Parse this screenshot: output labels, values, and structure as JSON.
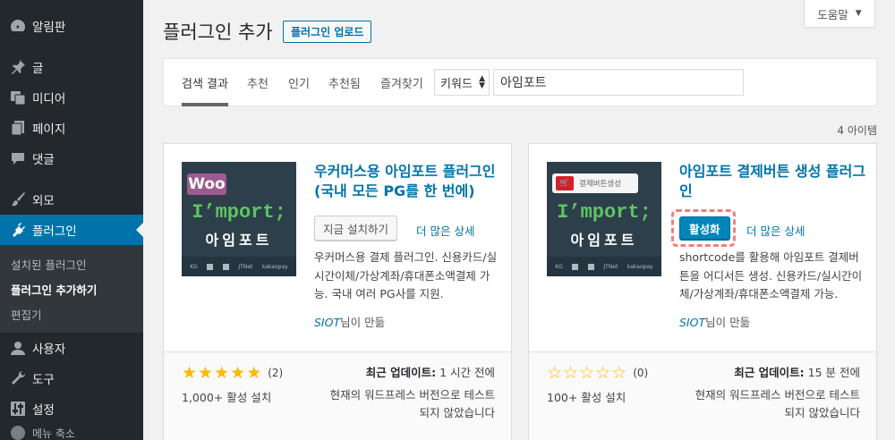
{
  "sidebar": {
    "items": [
      {
        "label": "알림판",
        "icon": "dashboard-icon"
      },
      {
        "label": "글",
        "icon": "pin-icon"
      },
      {
        "label": "미디어",
        "icon": "media-icon"
      },
      {
        "label": "페이지",
        "icon": "page-icon"
      },
      {
        "label": "댓글",
        "icon": "comment-icon"
      },
      {
        "label": "외모",
        "icon": "brush-icon"
      },
      {
        "label": "플러그인",
        "icon": "plugin-icon"
      },
      {
        "label": "사용자",
        "icon": "user-icon"
      },
      {
        "label": "도구",
        "icon": "wrench-icon"
      },
      {
        "label": "설정",
        "icon": "settings-icon"
      }
    ],
    "submenu": [
      "설치된 플러그인",
      "플러그인 추가하기",
      "편집기"
    ],
    "cutoff_label": "메뉴 축소"
  },
  "header": {
    "title": "플러그인 추가",
    "upload_label": "플러그인 업로드",
    "help_label": "도움말",
    "help_arrow": "▼"
  },
  "filter": {
    "tabs": [
      "검색 결과",
      "추천",
      "인기",
      "추천됨",
      "즐겨찾기"
    ],
    "search_type": "키워드",
    "search_value": "아임포트"
  },
  "result_count": "4 아이템",
  "plugins": [
    {
      "name": "우커머스용 아임포트 플러그인(국내 모든 PG를 한 번에)",
      "action_label": "지금 설치하기",
      "more_label": "더 많은 상세",
      "description": "우커머스용 결제 플러그인. 신용카드/실시간이체/가상계좌/휴대폰소액결제 가능. 국내 여러 PG사를 지원.",
      "author_name": "SIOT",
      "author_suffix": "님이 만듦",
      "rating": 5,
      "rating_count": "(2)",
      "installs": "1,000+ 활성 설치",
      "updated_label": "최근 업데이트:",
      "updated_value": "1 시간 전에",
      "compat": "현재의 워드프레스 버전으로 테스트 되지 않았습니다",
      "thumb_badge": "Woo",
      "thumb_logo": "I’mport;",
      "thumb_ko": "아임포트"
    },
    {
      "name": "아임포트 결제버튼 생성 플러그인",
      "action_label": "활성화",
      "more_label": "더 많은 상세",
      "description": "shortcode를 활용해 아임포트 결제버튼을 어디서든 생성. 신용카드/실시간이체/가상계좌/휴대폰소액결제 가능.",
      "author_name": "SIOT",
      "author_suffix": "님이 만듦",
      "rating": 0,
      "rating_count": "(0)",
      "installs": "100+ 활성 설치",
      "updated_label": "최근 업데이트:",
      "updated_value": "15 분 전에",
      "compat": "현재의 워드프레스 버전으로 테스트 되지 않았습니다",
      "thumb_badge": "결제버튼생성",
      "thumb_logo": "I’mport;",
      "thumb_ko": "아임포트"
    }
  ],
  "thumb_footer": [
    "KG",
    "JTNet",
    "kakaopay"
  ],
  "colors": {
    "sidebar_bg": "#23282d",
    "active_blue": "#0073aa",
    "star": "#ffb900",
    "woo_purple": "#9b5c8f",
    "import_green": "#5ec463",
    "highlight_dash": "#f08080"
  }
}
